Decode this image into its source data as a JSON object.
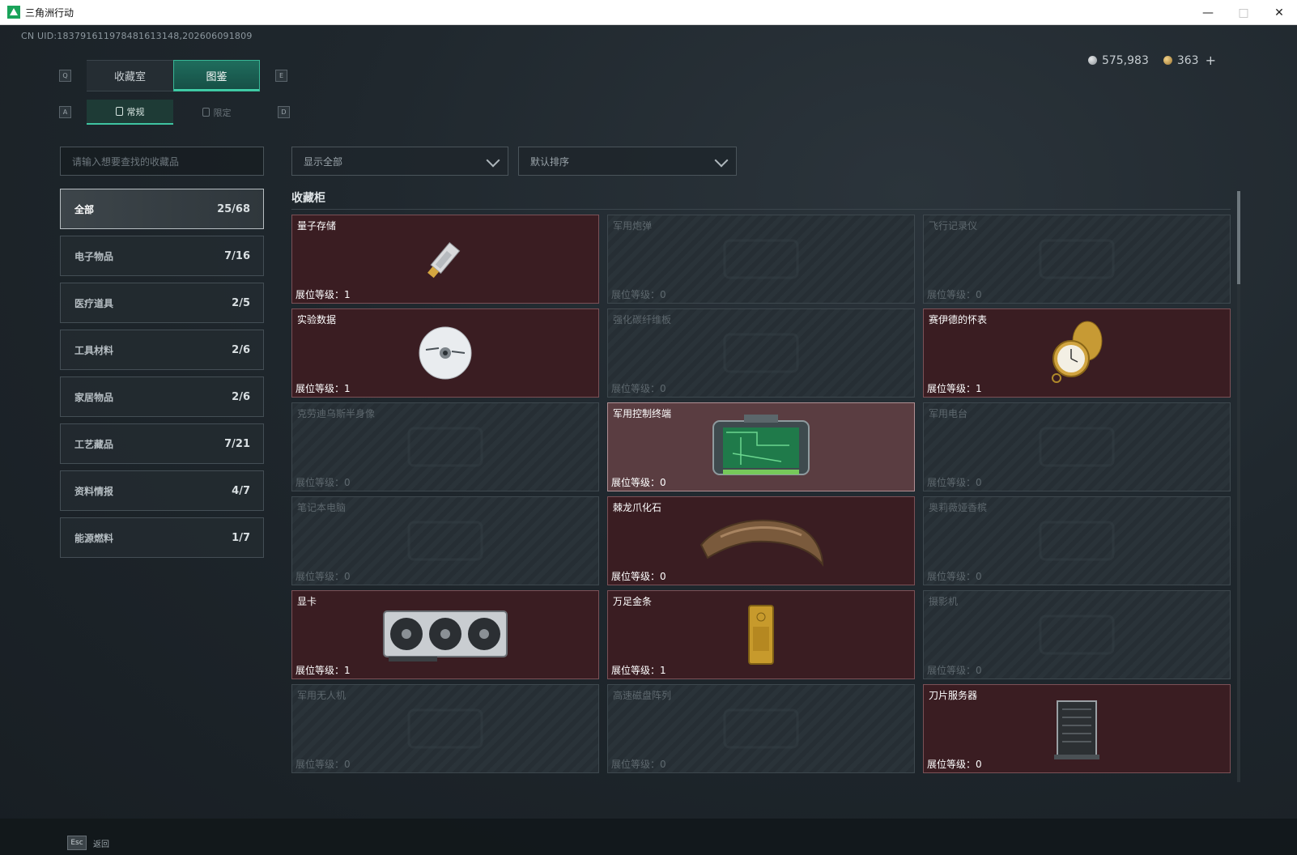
{
  "window": {
    "title": "三角洲行动",
    "controls": [
      "minimize-icon",
      "maximize-icon",
      "close-icon"
    ]
  },
  "uid": "CN UID:1837916119784816131​48,202606091809",
  "currency": {
    "silver": "575,983",
    "gold": "363",
    "add": "+"
  },
  "keys": {
    "q": "Q",
    "e": "E",
    "a": "A",
    "d": "D"
  },
  "main_tabs": [
    {
      "label": "收藏室",
      "active": false
    },
    {
      "label": "图鉴",
      "active": true
    }
  ],
  "sub_tabs": [
    {
      "label": "常规",
      "active": true
    },
    {
      "label": "限定",
      "active": false
    }
  ],
  "search": {
    "placeholder": "请输入想要查找的收藏品"
  },
  "filters": {
    "display": "显示全部",
    "sort": "默认排序"
  },
  "categories": [
    {
      "label": "全部",
      "count": "25/68",
      "active": true
    },
    {
      "label": "电子物品",
      "count": "7/16",
      "active": false
    },
    {
      "label": "医疗道具",
      "count": "2/5",
      "active": false
    },
    {
      "label": "工具材料",
      "count": "2/6",
      "active": false
    },
    {
      "label": "家居物品",
      "count": "2/6",
      "active": false
    },
    {
      "label": "工艺藏品",
      "count": "7/21",
      "active": false
    },
    {
      "label": "资料情报",
      "count": "4/7",
      "active": false
    },
    {
      "label": "能源燃料",
      "count": "1/7",
      "active": false
    }
  ],
  "section_title": "收藏柜",
  "level_label": "展位等级：",
  "items": [
    {
      "name": "量子存储",
      "level": "1",
      "state": "owned",
      "icon": "usb-stick-icon"
    },
    {
      "name": "军用炮弹",
      "level": "0",
      "state": "locked",
      "icon": "shell-icon"
    },
    {
      "name": "飞行记录仪",
      "level": "0",
      "state": "locked",
      "icon": "flight-recorder-icon"
    },
    {
      "name": "实验数据",
      "level": "1",
      "state": "owned",
      "icon": "disc-icon"
    },
    {
      "name": "强化碳纤维板",
      "level": "0",
      "state": "locked",
      "icon": "fiber-plate-icon"
    },
    {
      "name": "赛伊德的怀表",
      "level": "1",
      "state": "owned",
      "icon": "pocket-watch-icon"
    },
    {
      "name": "克劳迪乌斯半身像",
      "level": "0",
      "state": "locked",
      "icon": "bust-icon"
    },
    {
      "name": "军用控制终端",
      "level": "0",
      "state": "selected",
      "icon": "control-terminal-icon"
    },
    {
      "name": "军用电台",
      "level": "0",
      "state": "locked",
      "icon": "radio-icon"
    },
    {
      "name": "笔记本电脑",
      "level": "0",
      "state": "locked",
      "icon": "laptop-icon"
    },
    {
      "name": "棘龙爪化石",
      "level": "0",
      "state": "owned",
      "icon": "claw-fossil-icon"
    },
    {
      "name": "奥莉薇娅香槟",
      "level": "0",
      "state": "locked",
      "icon": "champagne-icon"
    },
    {
      "name": "显卡",
      "level": "1",
      "state": "owned",
      "icon": "graphics-card-icon"
    },
    {
      "name": "万足金条",
      "level": "1",
      "state": "owned",
      "icon": "gold-bar-icon"
    },
    {
      "name": "摄影机",
      "level": "0",
      "state": "locked",
      "icon": "camera-icon"
    },
    {
      "name": "军用无人机",
      "level": "0",
      "state": "locked",
      "icon": "drone-icon"
    },
    {
      "name": "高速磁盘阵列",
      "level": "0",
      "state": "locked",
      "icon": "disk-array-icon"
    },
    {
      "name": "刀片服务器",
      "level": "0",
      "state": "owned",
      "icon": "blade-server-icon"
    }
  ],
  "footer": {
    "esc_key": "Esc",
    "back_label": "返回"
  },
  "colors": {
    "accent": "#3fc3a1",
    "owned_card": "#3a1d22",
    "selected_card": "#5a3d41",
    "locked_card": "#262e34"
  }
}
